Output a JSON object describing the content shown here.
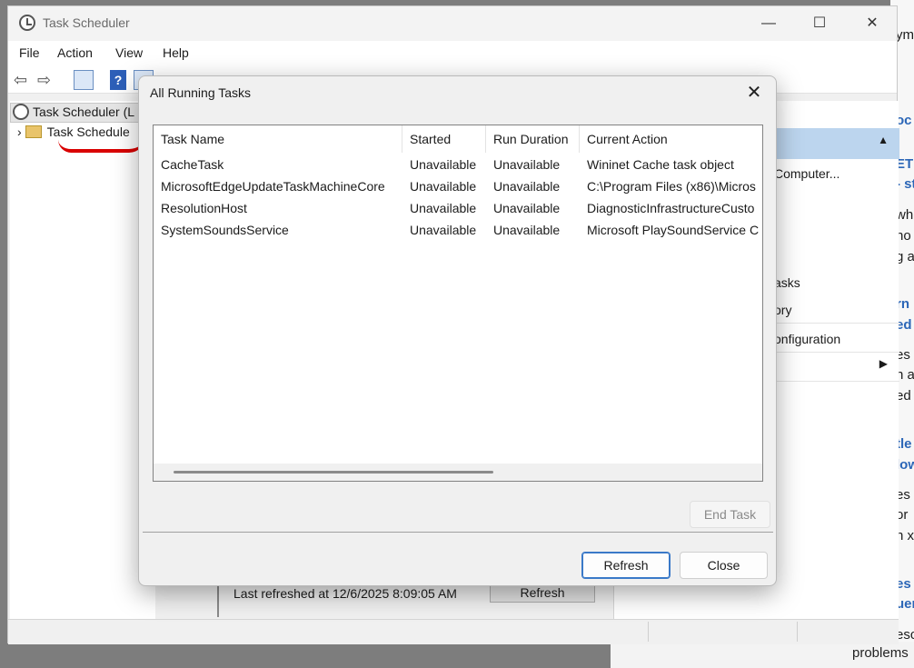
{
  "window": {
    "title": "Task Scheduler",
    "controls": {
      "minimize": "—",
      "maximize": "☐",
      "close": "✕"
    }
  },
  "menu": {
    "file": "File",
    "action": "Action",
    "view": "View",
    "help": "Help"
  },
  "tree": {
    "root_label": "Task Scheduler (L",
    "library_label": "Task Schedule"
  },
  "center_pane": {
    "last_refreshed": "Last refreshed at 12/6/2025 8:09:05 AM",
    "refresh_button": "Refresh"
  },
  "actions_pane": {
    "items": [
      "Computer...",
      "asks",
      "ory",
      "onfiguration"
    ]
  },
  "background_page": {
    "fragments": [
      "ym",
      "oc",
      "ET",
      "- st",
      "wh",
      "no",
      "g a",
      "rn",
      "ed",
      "es",
      "n a",
      "ed",
      "tle",
      "low",
      "es",
      "or",
      "n x",
      "es",
      "uer",
      "esc"
    ],
    "bottom_text": "problems"
  },
  "dialog": {
    "title": "All Running Tasks",
    "columns": [
      "Task Name",
      "Started",
      "Run Duration",
      "Current Action"
    ],
    "rows": [
      [
        "CacheTask",
        "Unavailable",
        "Unavailable",
        "Wininet Cache task object"
      ],
      [
        "MicrosoftEdgeUpdateTaskMachineCore",
        "Unavailable",
        "Unavailable",
        "C:\\Program Files (x86)\\Micros"
      ],
      [
        "ResolutionHost",
        "Unavailable",
        "Unavailable",
        "DiagnosticInfrastructureCusto"
      ],
      [
        "SystemSoundsService",
        "Unavailable",
        "Unavailable",
        "Microsoft PlaySoundService C"
      ]
    ],
    "end_task_button": "End Task",
    "refresh_button": "Refresh",
    "close_button": "Close"
  }
}
